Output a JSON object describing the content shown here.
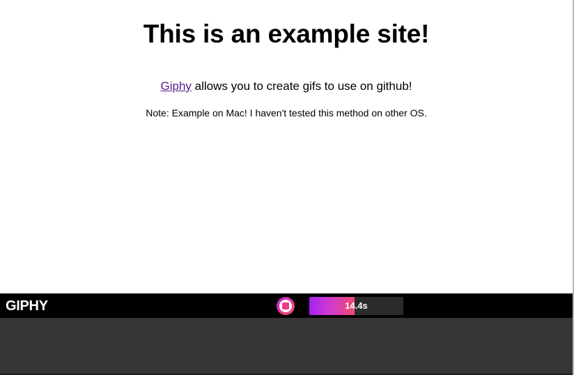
{
  "page": {
    "title": "This is an example site!",
    "intro": {
      "link_text": "Giphy",
      "text": " allows you to create gifs to use on github!"
    },
    "note": "Note: Example on Mac! I haven't tested this method on other OS."
  },
  "recorder": {
    "brand": "GIPHY",
    "timer_label": "14.4s",
    "progress_fraction": 0.48,
    "stop_icon": "stop-record-icon"
  },
  "colors": {
    "link": "#551a8b",
    "bar_background": "#000000",
    "panel_background": "#363436",
    "accent_purple": "#a523f0",
    "accent_pink": "#ee4a6e"
  }
}
